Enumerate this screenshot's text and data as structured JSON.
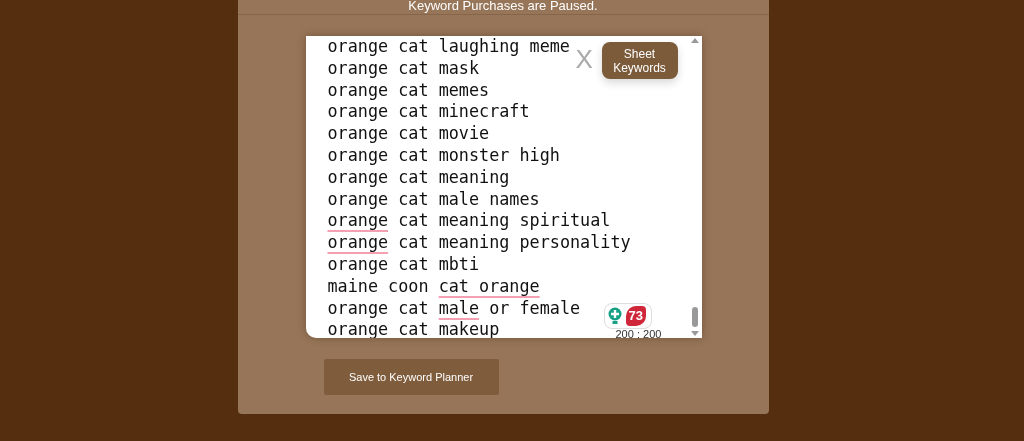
{
  "notice": "Keyword Purchases are Paused.",
  "keywords": [
    [
      {
        "text": "orange cat laughing meme",
        "flagged": false
      }
    ],
    [
      {
        "text": "orange cat mask",
        "flagged": false
      }
    ],
    [
      {
        "text": "orange cat memes",
        "flagged": false
      }
    ],
    [
      {
        "text": "orange cat minecraft",
        "flagged": false
      }
    ],
    [
      {
        "text": "orange cat movie",
        "flagged": false
      }
    ],
    [
      {
        "text": "orange cat monster high",
        "flagged": false
      }
    ],
    [
      {
        "text": "orange cat meaning",
        "flagged": false
      }
    ],
    [
      {
        "text": "orange cat male names",
        "flagged": false
      }
    ],
    [
      {
        "text": "orange",
        "flagged": true
      },
      {
        "text": " cat meaning spiritual",
        "flagged": false
      }
    ],
    [
      {
        "text": "orange",
        "flagged": true
      },
      {
        "text": " cat meaning personality",
        "flagged": false
      }
    ],
    [
      {
        "text": "orange cat mbti",
        "flagged": false
      }
    ],
    [
      {
        "text": "maine coon ",
        "flagged": false
      },
      {
        "text": "cat orange",
        "flagged": true
      }
    ],
    [
      {
        "text": "orange cat ",
        "flagged": false
      },
      {
        "text": "male",
        "flagged": true
      },
      {
        "text": " or female",
        "flagged": false
      }
    ],
    [
      {
        "text": "orange cat makeup",
        "flagged": false
      }
    ]
  ],
  "close_label": "X",
  "sheet_button": "Sheet Keywords",
  "grammar_badge": {
    "count": "73"
  },
  "counter": "200 : 200",
  "save_button": "Save to Keyword Planner"
}
